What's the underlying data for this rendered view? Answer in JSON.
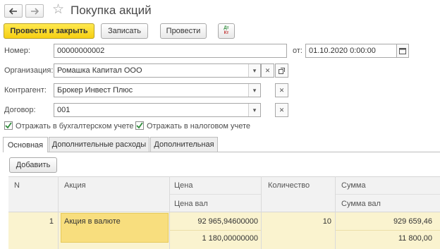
{
  "window": {
    "title": "Покупка акций"
  },
  "toolbar": {
    "post_close": "Провести и закрыть",
    "write": "Записать",
    "post": "Провести",
    "dt_kt_top": "Дт",
    "dt_kt_bottom": "Кт"
  },
  "form": {
    "number_label": "Номер:",
    "number_value": "00000000002",
    "date_label": "от:",
    "date_value": "01.10.2020  0:00:00",
    "org_label": "Организация:",
    "org_value": "Ромашка Капитал ООО",
    "counterparty_label": "Контрагент:",
    "counterparty_value": "Брокер Инвест Плюс",
    "contract_label": "Договор:",
    "contract_value": "001",
    "chk_accounting_label": "Отражать в бухгалтерском учете",
    "chk_accounting_checked": true,
    "chk_tax_label": "Отражать в налоговом учете",
    "chk_tax_checked": true
  },
  "tabs": [
    {
      "label": "Основная",
      "active": true
    },
    {
      "label": "Дополнительные расходы",
      "active": false
    },
    {
      "label": "Дополнительная",
      "active": false
    }
  ],
  "table": {
    "add_button": "Добавить",
    "columns": {
      "n": "N",
      "stock": "Акция",
      "price": "Цена",
      "price_cur": "Цена вал",
      "qty": "Количество",
      "sum": "Сумма",
      "sum_cur": "Сумма вал"
    },
    "rows": [
      {
        "n": "1",
        "stock": "Акция в валюте",
        "price": "92 965,94600000",
        "price_cur": "1 180,00000000",
        "qty": "10",
        "sum": "929 659,46",
        "sum_cur": "11 800,00"
      }
    ]
  },
  "colors": {
    "primary_button": "#f6cf12",
    "selected_row": "#faf3cf",
    "selected_cell": "#f8de7e",
    "checkbox_mark": "#2e8b3a"
  }
}
